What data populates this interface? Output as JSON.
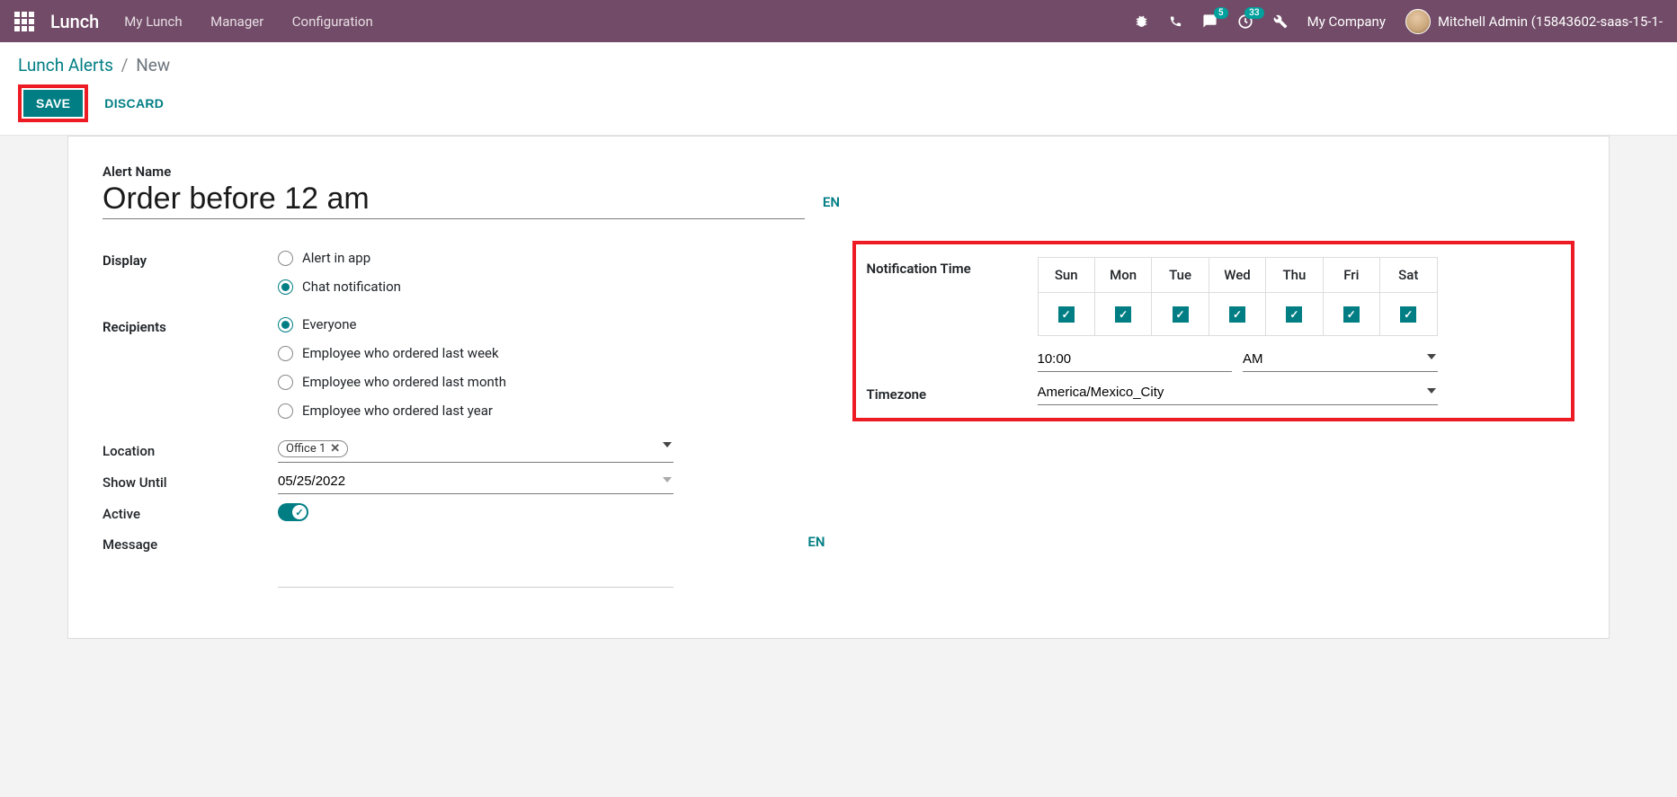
{
  "topbar": {
    "brand": "Lunch",
    "links": [
      "My Lunch",
      "Manager",
      "Configuration"
    ],
    "messages_badge": "5",
    "activities_badge": "33",
    "company": "My Company",
    "user": "Mitchell Admin (15843602-saas-15-1-"
  },
  "breadcrumb": {
    "parent": "Lunch Alerts",
    "current": "New"
  },
  "actions": {
    "save": "SAVE",
    "discard": "DISCARD"
  },
  "form": {
    "alert_name_label": "Alert Name",
    "alert_name_value": "Order before 12 am",
    "lang": "EN",
    "display_label": "Display",
    "display_options": [
      "Alert in app",
      "Chat notification"
    ],
    "recipients_label": "Recipients",
    "recipients_options": [
      "Everyone",
      "Employee who ordered last week",
      "Employee who ordered last month",
      "Employee who ordered last year"
    ],
    "location_label": "Location",
    "location_tag": "Office 1",
    "show_until_label": "Show Until",
    "show_until_value": "05/25/2022",
    "active_label": "Active",
    "message_label": "Message"
  },
  "notif": {
    "time_label": "Notification Time",
    "days": [
      "Sun",
      "Mon",
      "Tue",
      "Wed",
      "Thu",
      "Fri",
      "Sat"
    ],
    "time_value": "10:00",
    "ampm": "AM",
    "tz_label": "Timezone",
    "tz_value": "America/Mexico_City"
  }
}
